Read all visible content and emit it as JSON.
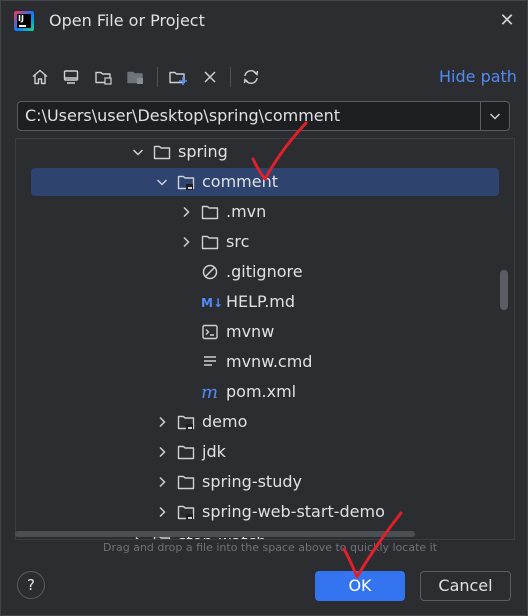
{
  "window": {
    "title": "Open File or Project",
    "close_glyph": "✕"
  },
  "toolbar": {
    "buttons": [
      "home-icon",
      "desktop-icon",
      "project-directory-icon",
      "module-directory-icon",
      "new-folder-icon",
      "delete-icon",
      "refresh-icon"
    ],
    "hide_path_label": "Hide path"
  },
  "path_field": {
    "value": "C:\\Users\\user\\Desktop\\spring\\comment"
  },
  "tree": {
    "rows": [
      {
        "label": "spring",
        "expanded": true,
        "icon": "folder-icon"
      },
      {
        "label": "comment",
        "expanded": true,
        "icon": "project-folder-icon",
        "selected": true
      },
      {
        "label": ".mvn",
        "expanded": false,
        "icon": "folder-icon"
      },
      {
        "label": "src",
        "expanded": false,
        "icon": "folder-icon"
      },
      {
        "label": ".gitignore",
        "icon": "ignore-file-icon"
      },
      {
        "label": "HELP.md",
        "icon": "markdown-file-icon",
        "icon_text": "M↓"
      },
      {
        "label": "mvnw",
        "icon": "terminal-file-icon"
      },
      {
        "label": "mvnw.cmd",
        "icon": "text-file-icon"
      },
      {
        "label": "pom.xml",
        "icon": "maven-file-icon",
        "icon_text": "m"
      },
      {
        "label": "demo",
        "expanded": false,
        "icon": "project-folder-icon"
      },
      {
        "label": "jdk",
        "expanded": false,
        "icon": "folder-icon"
      },
      {
        "label": "spring-study",
        "expanded": false,
        "icon": "folder-icon"
      },
      {
        "label": "spring-web-start-demo",
        "expanded": false,
        "icon": "project-folder-icon"
      },
      {
        "label": "stop-watch",
        "expanded": false,
        "icon": "folder-icon"
      }
    ]
  },
  "hint": "Drag and drop a file into the space above to quickly locate it",
  "footer": {
    "help_label": "?",
    "ok_label": "OK",
    "cancel_label": "Cancel"
  },
  "colors": {
    "accent": "#3574f0",
    "link": "#548af7",
    "selection": "#2e436e",
    "annotation": "#e0202a"
  }
}
